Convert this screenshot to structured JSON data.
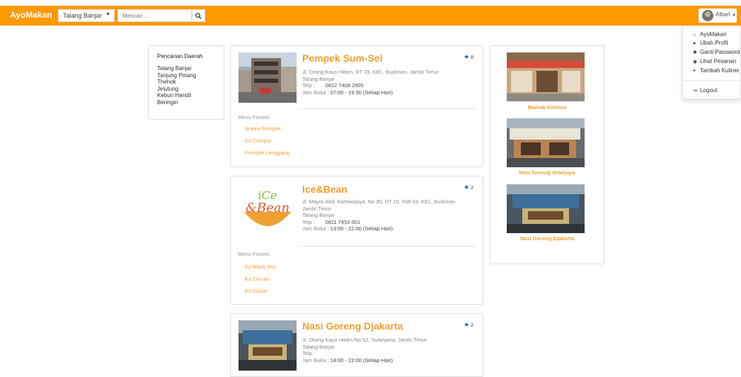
{
  "navbar": {
    "brand": "AyoMakan",
    "region_select": "Talang Banjar",
    "search_placeholder": "Mencari ..."
  },
  "user": {
    "name": "Albert",
    "menu": [
      "AyoMakan",
      "Ubah Profil",
      "Ganti Password",
      "Lihat Pesanan",
      "Tambah Kuliner",
      "Logout"
    ]
  },
  "sidebar": {
    "title": "Pencarian Daerah",
    "areas": [
      "Talang Banjar",
      "Tanjung Pinang",
      "Thehok",
      "Jelutung",
      "Kebun Handil",
      "Beringin"
    ]
  },
  "listings": [
    {
      "name": "Pempek Sum-Sel",
      "rating": "8",
      "address": "Jl. Orang Kayo Hitam, RT 15, KEL. Budiman, Jambi Timur",
      "area": "Talang Banjar",
      "phone_label": "Telp :",
      "phone": "0812 7408 2905",
      "hours_label": "Jam Buka :",
      "hours": "07:00 - 19:30 (Setiap Hari)",
      "menu_label": "Menu Favorit:",
      "menu": [
        "Aneka Pempek",
        "Es Campur",
        "Pempek Lenggang"
      ]
    },
    {
      "name": "Ice&Bean",
      "rating": "2",
      "address": "Jl. Mayor Abd. Kartawijaya, No 30, RT 15, RW 03, KEL. Budiman, Jambi Timur",
      "area": "Talang Banjar",
      "phone_label": "Telp :",
      "phone": "0811 7453 001",
      "hours_label": "Jam Buka :",
      "hours": "13:00 - 22:00 (Setiap Hari)",
      "menu_label": "Menu Favorit:",
      "menu": [
        "Es Black Tea",
        "Es Cincau",
        "Es Durian"
      ],
      "logo_text_top": "iCe",
      "logo_text_bottom": "&Bean"
    },
    {
      "name": "Nasi Goreng Djakarta",
      "rating": "2",
      "address": "Jl. Orang Kayo Hitam No.62, Sulanjana, Jambi Timur",
      "area": "Talang Banjar",
      "phone_label": "Telp :",
      "phone": "",
      "hours_label": "Jam Buka :",
      "hours": "14:00 - 22:00 (Setiap Hari)"
    }
  ],
  "recommendations": [
    {
      "name": "Mamak Kitchen"
    },
    {
      "name": "Nasi Goreng Sriwijaya"
    },
    {
      "name": "Nasi Goreng Djakarta"
    }
  ],
  "colors": {
    "navbar": "#ff9900",
    "accent": "#f0a030",
    "star": "#2a5fb0"
  }
}
